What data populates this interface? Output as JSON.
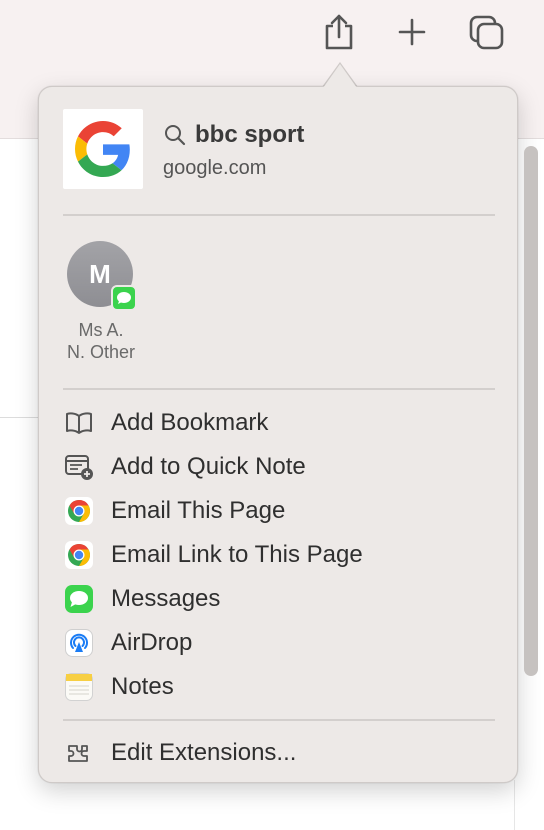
{
  "toolbar": {
    "share_icon": "share-icon",
    "new_tab_icon": "plus-icon",
    "tabs_icon": "tab-overview-icon"
  },
  "share_sheet": {
    "header": {
      "title": "bbc sport",
      "subtitle": "google.com",
      "thumbnail_icon": "google-logo-icon"
    },
    "contacts": [
      {
        "initial": "M",
        "name_line1": "Ms A.",
        "name_line2": "N. Other",
        "badge": "messages-icon"
      }
    ],
    "actions": [
      {
        "label": "Add Bookmark",
        "icon": "bookmark-book-icon"
      },
      {
        "label": "Add to Quick Note",
        "icon": "quick-note-icon"
      },
      {
        "label": "Email This Page",
        "icon": "chrome-icon"
      },
      {
        "label": "Email Link to This Page",
        "icon": "chrome-icon"
      },
      {
        "label": "Messages",
        "icon": "messages-icon"
      },
      {
        "label": "AirDrop",
        "icon": "airdrop-icon"
      },
      {
        "label": "Notes",
        "icon": "notes-icon"
      }
    ],
    "footer": {
      "label": "Edit Extensions...",
      "icon": "extensions-icon"
    }
  },
  "colors": {
    "toolbar_bg": "#f7f1f1",
    "popover_bg": "#ede9e7",
    "messages_green": "#3bd34d",
    "google_blue": "#4285F4",
    "google_red": "#EA4335",
    "google_yellow": "#FBBC05",
    "google_green": "#34A853"
  }
}
